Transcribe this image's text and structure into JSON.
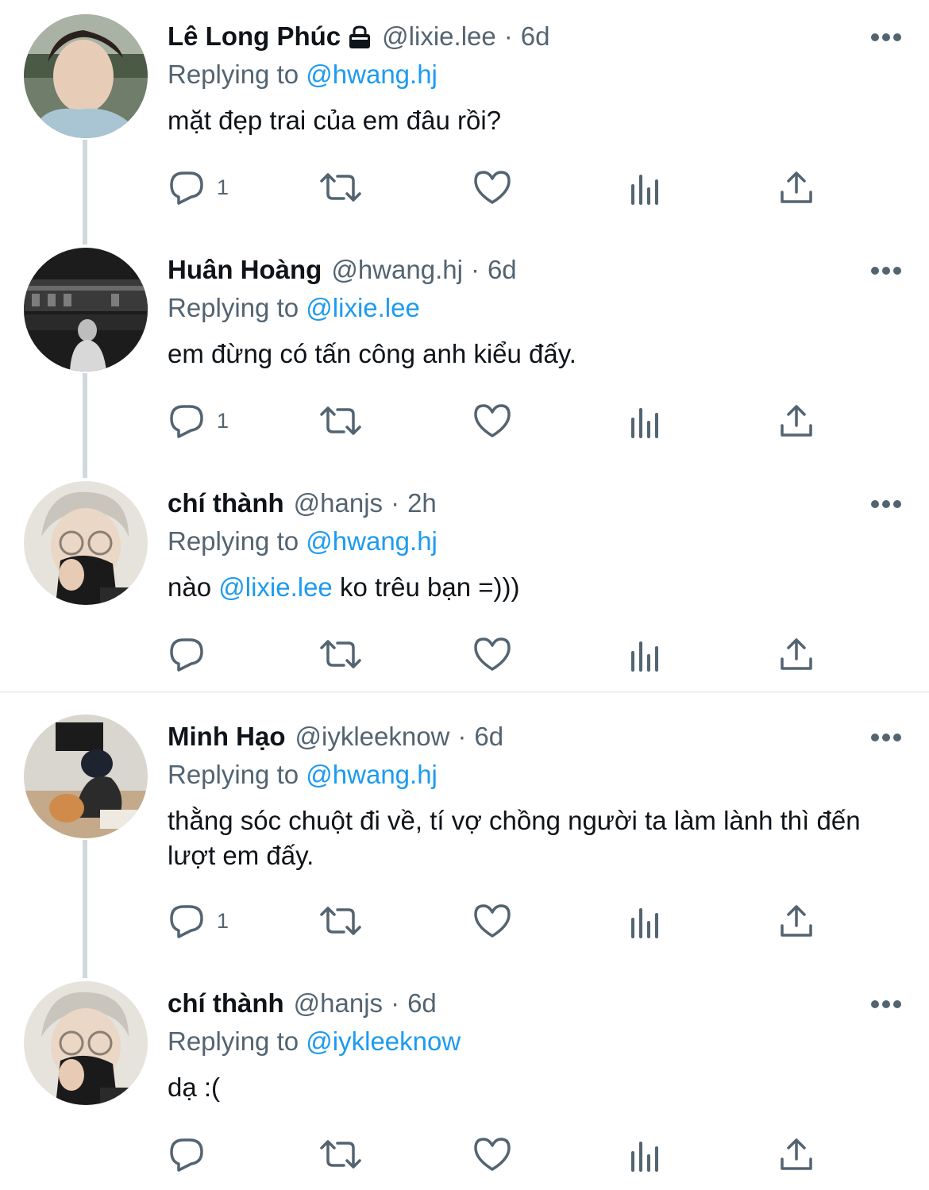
{
  "replying_label": "Replying to",
  "tweets": [
    {
      "display_name": "Lê Long Phúc",
      "locked": true,
      "handle": "@lixie.lee",
      "separator": "·",
      "time": "6d",
      "replying_to": "@hwang.hj",
      "text": "mặt đẹp trai của em đâu rồi?",
      "reply_count": "1"
    },
    {
      "display_name": "Huân Hoàng",
      "handle": "@hwang.hj",
      "separator": "·",
      "time": "6d",
      "replying_to": "@lixie.lee",
      "text": "em đừng có tấn công anh kiểu đấy.",
      "reply_count": "1"
    },
    {
      "display_name": "chí thành",
      "handle": "@hanjs",
      "separator": "·",
      "time": "2h",
      "replying_to": "@hwang.hj",
      "text_before": "nào ",
      "text_mention": "@lixie.lee",
      "text_after": " ko trêu bạn =)))",
      "reply_count": ""
    },
    {
      "display_name": "Minh Hạo",
      "handle": "@iykleeknow",
      "separator": "·",
      "time": "6d",
      "replying_to": "@hwang.hj",
      "text": "thằng sóc chuột đi về, tí vợ chồng người ta làm lành thì đến lượt em đấy.",
      "reply_count": "1"
    },
    {
      "display_name": "chí thành",
      "handle": "@hanjs",
      "separator": "·",
      "time": "6d",
      "replying_to": "@iykleeknow",
      "text": "dạ :(",
      "reply_count": ""
    }
  ],
  "colors": {
    "text_primary": "#0f1419",
    "text_secondary": "#536471",
    "link": "#1d9bf0",
    "thread_line": "#cfd9de",
    "divider": "#eff3f4"
  },
  "icons": [
    "reply-icon",
    "retweet-icon",
    "like-icon",
    "analytics-icon",
    "share-icon",
    "more-icon",
    "lock-icon"
  ]
}
